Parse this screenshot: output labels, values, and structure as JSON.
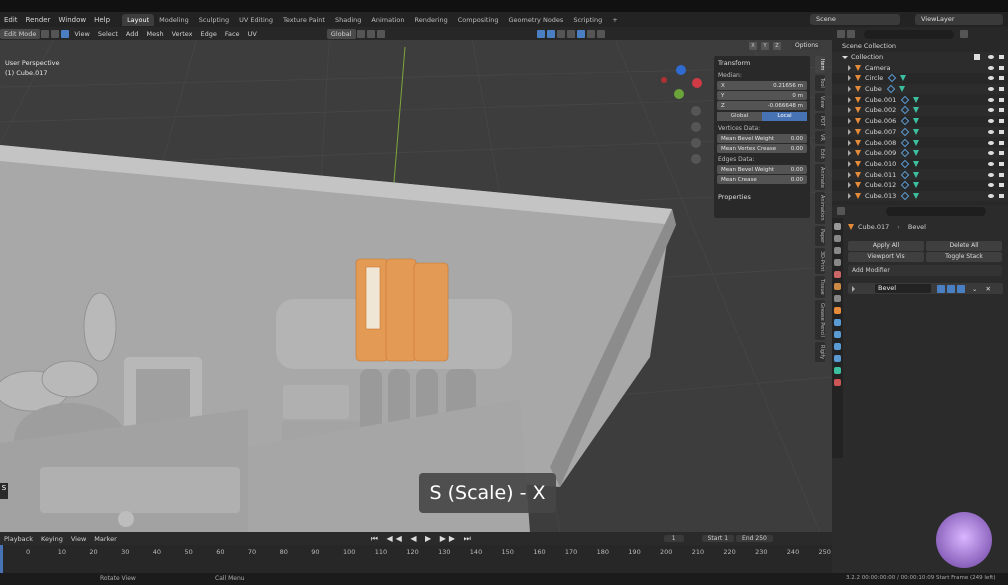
{
  "menu": {
    "items": [
      "Edit",
      "Render",
      "Window",
      "Help"
    ],
    "workspaces": [
      "Layout",
      "Modeling",
      "Sculpting",
      "UV Editing",
      "Texture Paint",
      "Shading",
      "Animation",
      "Rendering",
      "Compositing",
      "Geometry Nodes",
      "Scripting"
    ],
    "plus": "+",
    "scene": "Scene",
    "view_layer": "ViewLayer"
  },
  "viewport": {
    "mode": "Edit Mode",
    "menus": [
      "View",
      "Select",
      "Add",
      "Mesh",
      "Vertex",
      "Edge",
      "Face",
      "UV"
    ],
    "orientation": "Global",
    "options_label": "Options",
    "axis_labels": [
      "X",
      "Y",
      "Z"
    ],
    "perspective": "User Perspective",
    "object": "(1) Cube.017",
    "overlay_key": "S (Scale) - X",
    "edge_letter": "s"
  },
  "npanel": {
    "title": "Transform",
    "median_label": "Median:",
    "x_label": "X",
    "x_value": "0.21656 m",
    "y_label": "Y",
    "y_value": "0 m",
    "z_label": "Z",
    "z_value": "-0.066648 m",
    "global_label": "Global",
    "local_label": "Local",
    "vertices_label": "Vertices Data:",
    "mean_bevel_weight_label": "Mean Bevel Weight",
    "mean_bevel_weight_value": "0.00",
    "mean_vertex_crease_label": "Mean Vertex Crease",
    "mean_vertex_crease_value": "0.00",
    "edges_label": "Edges Data:",
    "edge_bevel_label": "Mean Bevel Weight",
    "edge_bevel_value": "0.00",
    "mean_crease_label": "Mean Crease",
    "mean_crease_value": "0.00",
    "properties_label": "Properties",
    "side_tabs": [
      "Item",
      "Tool",
      "View",
      "PDT",
      "VR",
      "Edit",
      "Animate",
      "Animation",
      "Paper",
      "3D-Print",
      "Tissue",
      "Grease Pencil",
      "Rigify"
    ]
  },
  "outliner": {
    "scene_collection": "Scene Collection",
    "collection": "Collection",
    "objects": [
      "Camera",
      "Circle",
      "Cube",
      "Cube.001",
      "Cube.002",
      "Cube.006",
      "Cube.007",
      "Cube.008",
      "Cube.009",
      "Cube.010",
      "Cube.011",
      "Cube.012",
      "Cube.013"
    ]
  },
  "properties": {
    "object": "Cube.017",
    "modifier_breadcrumb": "Bevel",
    "apply_all": "Apply All",
    "delete_all": "Delete All",
    "viewport_vis": "Viewport Vis",
    "toggle_stack": "Toggle Stack",
    "add_modifier": "Add Modifier",
    "modifier_name": "Bevel"
  },
  "timeline": {
    "menus": [
      "Playback",
      "Keying",
      "View",
      "Marker"
    ],
    "current_frame": "1",
    "start_label": "Start",
    "start": "1",
    "end_label": "End",
    "end": "250",
    "ticks": [
      "0",
      "10",
      "20",
      "30",
      "40",
      "50",
      "60",
      "70",
      "80",
      "90",
      "100",
      "110",
      "120",
      "130",
      "140",
      "150",
      "160",
      "170",
      "180",
      "190",
      "200",
      "210",
      "220",
      "230",
      "240",
      "250"
    ]
  },
  "status": {
    "left": "Rotate View",
    "middle": "Call Menu",
    "right": "3.2.2  00:00:00:00 / 00:00:10:09  Start Frame (249 left)"
  },
  "colors": {
    "accent": "#4772b3",
    "selection": "#e58b3a",
    "viewport_bg": "#3d3d3d"
  }
}
